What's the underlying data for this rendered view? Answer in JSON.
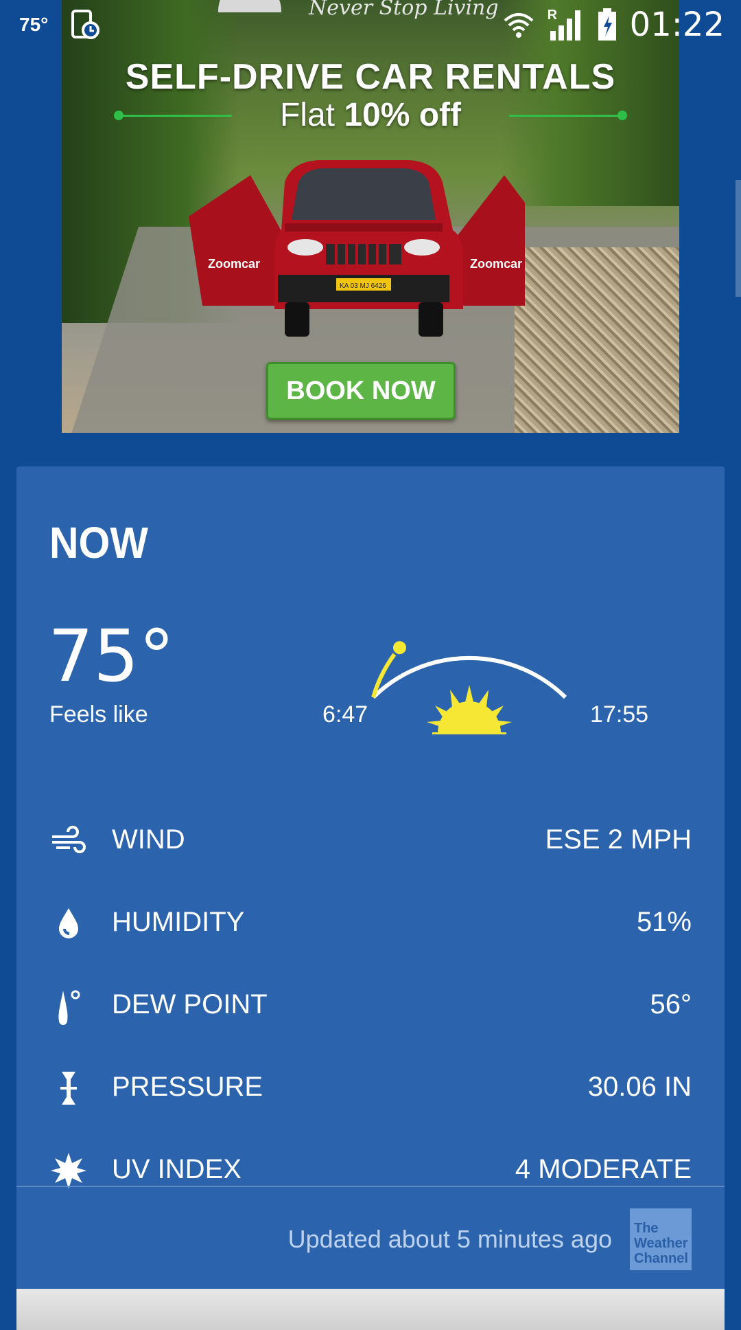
{
  "status_bar": {
    "temperature": "75°",
    "network_indicator": "R",
    "time": "01:22",
    "icons": [
      "notification-clock-icon",
      "wifi-icon",
      "signal-icon",
      "battery-icon"
    ]
  },
  "ad": {
    "tagline": "Never Stop Living",
    "title": "SELF-DRIVE CAR RENTALS",
    "subtitle_prefix": "Flat ",
    "subtitle_bold": "10% off",
    "cta": "BOOK NOW",
    "plate": "KA 03 MJ 6426",
    "door_brand": "Zoomcar"
  },
  "now": {
    "title": "NOW",
    "temperature": "75°",
    "feels_like_label": "Feels like",
    "sunrise": "6:47",
    "sunset": "17:55",
    "sun_progress": 0.22,
    "details": [
      {
        "icon": "wind-icon",
        "label": "WIND",
        "value": "ESE 2 MPH"
      },
      {
        "icon": "humidity-drop-icon",
        "label": "HUMIDITY",
        "value": "51%"
      },
      {
        "icon": "dew-point-icon",
        "label": "DEW POINT",
        "value": "56°"
      },
      {
        "icon": "pressure-icon",
        "label": "PRESSURE",
        "value": "30.06 IN"
      },
      {
        "icon": "uv-sun-icon",
        "label": "UV INDEX",
        "value": "4 MODERATE"
      }
    ],
    "updated": "Updated about 5 minutes ago",
    "brand": "The Weather Channel"
  },
  "colors": {
    "background": "#0f4a94",
    "card": "#2b64ad",
    "sun_yellow": "#f5e733",
    "cta_green": "#5cb544"
  }
}
